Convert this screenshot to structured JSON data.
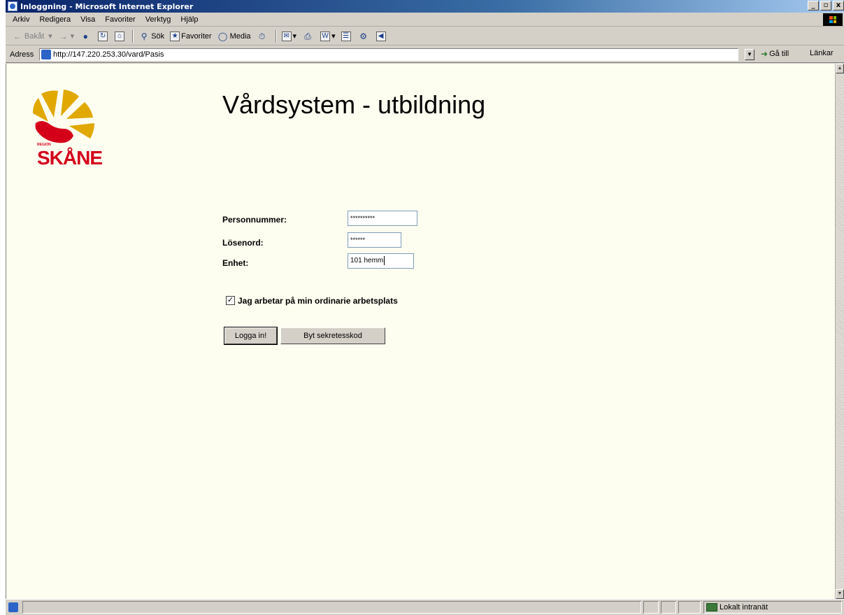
{
  "window": {
    "title": "Inloggning - Microsoft Internet Explorer",
    "controls": [
      "_",
      "▫",
      "x"
    ]
  },
  "menu": [
    "Arkiv",
    "Redigera",
    "Visa",
    "Favoriter",
    "Verktyg",
    "Hjälp"
  ],
  "toolbar": {
    "back": "Bakåt",
    "search": "Sök",
    "favorites": "Favoriter",
    "media": "Media"
  },
  "address": {
    "label": "Adress",
    "url": "http://147.220.253.30/vard/Pasis",
    "go": "Gå till",
    "links": "Länkar"
  },
  "page": {
    "logo_text": "SKÅNE",
    "logo_small": "REGION",
    "title": "Vårdsystem - utbildning",
    "form": {
      "personnummer_label": "Personnummer:",
      "personnummer_value": "**********",
      "losenord_label": "Lösenord:",
      "losenord_value": "******",
      "enhet_label": "Enhet:",
      "enhet_value": "101 hemm",
      "checkbox_label": "Jag arbetar på min ordinarie arbetsplats",
      "checkbox_checked": true,
      "login_button": "Logga in!",
      "change_code_button": "Byt sekretesskod"
    }
  },
  "status": {
    "zone": "Lokalt intranät"
  },
  "colors": {
    "content_bg": "#fdfdf0",
    "logo_red": "#d4001a",
    "logo_yellow": "#e0a800"
  }
}
